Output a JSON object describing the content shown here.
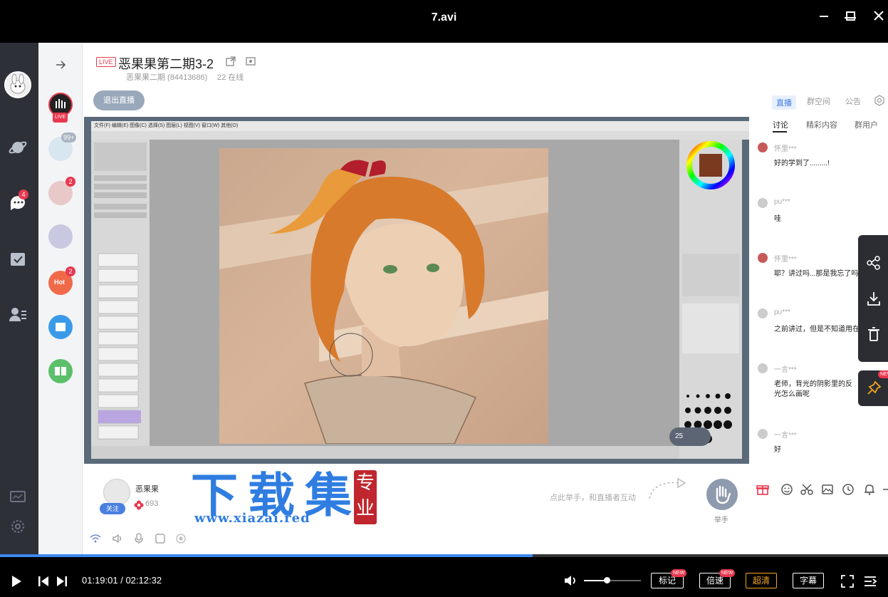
{
  "player": {
    "title": "7.avi",
    "time_current": "01:19:01",
    "time_total": "02:12:32",
    "time_sep": " / ",
    "progress": 0.6,
    "volume": 0.4,
    "buttons": {
      "mark": "标记",
      "speed": "倍速",
      "quality": "超清",
      "subtitle": "字幕"
    },
    "new_badge": "NEW"
  },
  "rail": {
    "chat_badge": "4"
  },
  "groups": {
    "live_label": "LIVE",
    "badge_99": "99+",
    "badge_2a": "2",
    "badge_2b": "2",
    "hot_label": "Hot"
  },
  "header": {
    "live_tag": "LIVE",
    "title": "恶果果第二期3-2",
    "group_id": "恶果果二期 (84413686)",
    "online": "22 在线",
    "exit_button": "退出直播"
  },
  "canvas": {
    "menu": "文件(F)  编辑(E)  图像(C)  选择(S)  图层(L)  视图(V)  窗口(W)  其他(O)",
    "zoom": "25"
  },
  "right_panel": {
    "tabs": [
      "直播",
      "群空间",
      "公告"
    ],
    "subtabs": [
      "讨论",
      "精彩内容",
      "群用户"
    ],
    "messages": [
      {
        "name": "怀里***",
        "text": "好的学到了.........!"
      },
      {
        "name": "pu***",
        "text": "哇"
      },
      {
        "name": "怀里***",
        "text": "耶？讲过吗...那是我忘了吗...?"
      },
      {
        "name": "pu***",
        "text": "之前讲过，但是不知道用在哪"
      },
      {
        "name": "一言***",
        "text": "老师，背光的阴影里的反光怎么画呢"
      },
      {
        "name": "一言***",
        "text": "好"
      }
    ]
  },
  "host": {
    "name": "恶果果",
    "follow": "关注",
    "fans": "693",
    "raise_hint": "点此举手，和直播者互动",
    "raise_label": "举手"
  },
  "watermark": {
    "text": "下载集",
    "url": "www.xiazai.red",
    "seal": "专业"
  },
  "colors": {
    "accent": "#3b7be0",
    "badge": "#e8384f",
    "quality_highlight": "#f5a623"
  }
}
